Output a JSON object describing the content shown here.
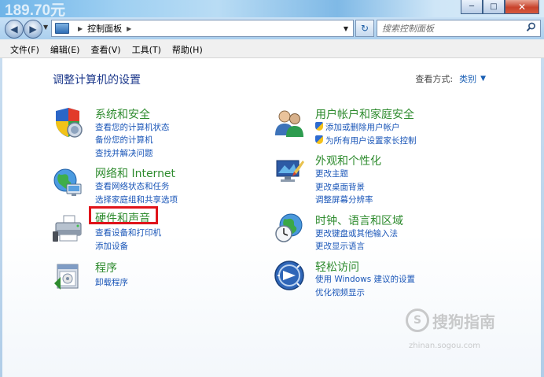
{
  "window": {
    "background_text": "189.70元",
    "min_label": "─",
    "max_label": "□",
    "close_label": "✕"
  },
  "nav": {
    "breadcrumb": "控制面板",
    "search_placeholder": "搜索控制面板",
    "refresh_label": "↻"
  },
  "menu": [
    "文件(F)",
    "编辑(E)",
    "查看(V)",
    "工具(T)",
    "帮助(H)"
  ],
  "main": {
    "title": "调整计算机的设置",
    "view_by_label": "查看方式:",
    "view_by_value": "类别"
  },
  "categories": {
    "system": {
      "title": "系统和安全",
      "links": [
        "查看您的计算机状态",
        "备份您的计算机",
        "查找并解决问题"
      ]
    },
    "network": {
      "title": "网络和 Internet",
      "links": [
        "查看网络状态和任务",
        "选择家庭组和共享选项"
      ]
    },
    "hardware": {
      "title": "硬件和声音",
      "links": [
        "查看设备和打印机",
        "添加设备"
      ]
    },
    "programs": {
      "title": "程序",
      "links": [
        "卸载程序"
      ]
    },
    "users": {
      "title": "用户帐户和家庭安全",
      "links": [
        "添加或删除用户帐户",
        "为所有用户设置家长控制"
      ]
    },
    "appearance": {
      "title": "外观和个性化",
      "links": [
        "更改主题",
        "更改桌面背景",
        "调整屏幕分辨率"
      ]
    },
    "clock": {
      "title": "时钟、语言和区域",
      "links": [
        "更改键盘或其他输入法",
        "更改显示语言"
      ]
    },
    "ease": {
      "title": "轻松访问",
      "links": [
        "使用 Windows 建议的设置",
        "优化视频显示"
      ]
    }
  },
  "watermark": {
    "brand": "搜狗指南",
    "url": "zhinan.sogou.com"
  },
  "colors": {
    "category_title": "#2e8b2e",
    "link": "#1a56b8",
    "highlight": "#e0141b",
    "page_title": "#1e3a8c"
  }
}
